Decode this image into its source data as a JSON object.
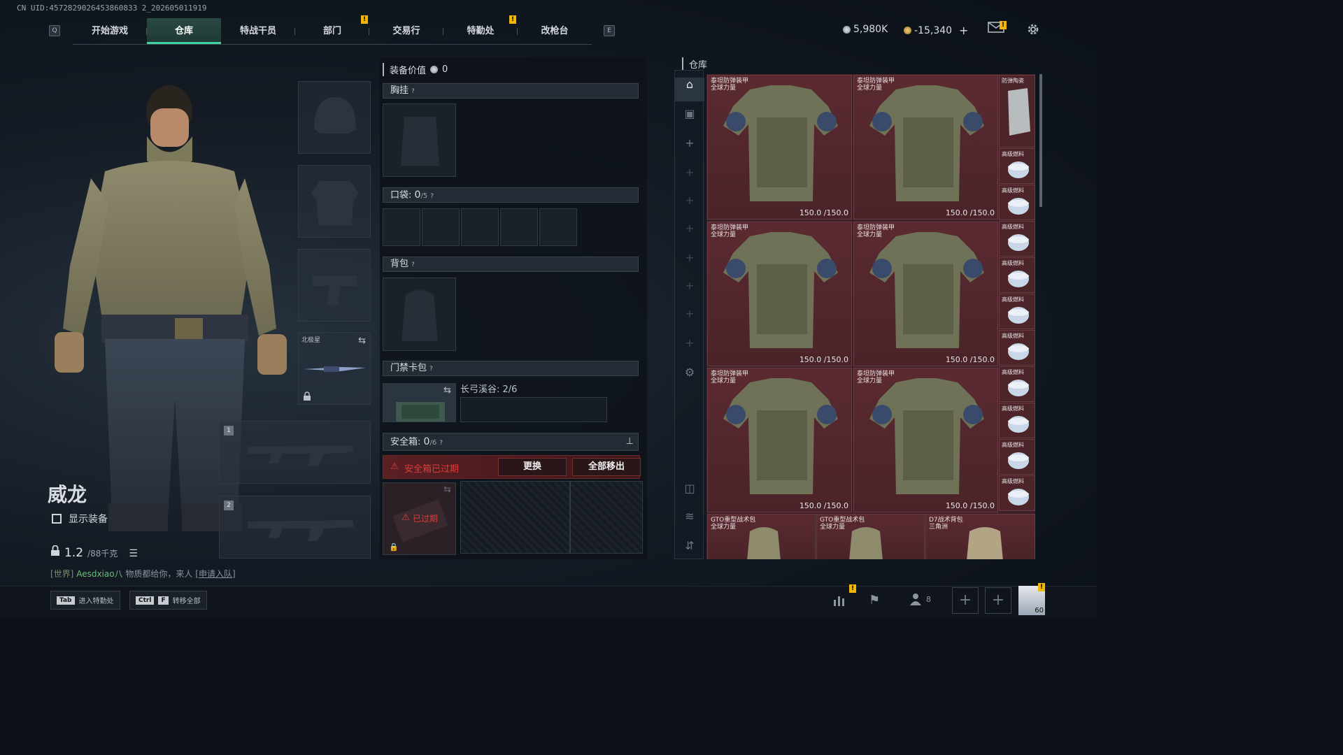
{
  "uid": "CN UID:4572829026453860833 2_202605011919",
  "topbar": {
    "keycap_left": "Q",
    "keycap_right": "E",
    "tabs": [
      "开始游戏",
      "仓库",
      "特战干员",
      "部门",
      "交易行",
      "特勤处",
      "改枪台"
    ],
    "active_tab": "仓库",
    "badge_mark": "!",
    "currency_silver": "5,980K",
    "currency_gold": "-15,340",
    "currency_add": "+"
  },
  "character": {
    "name": "威龙",
    "show_gear_label": "显示装备",
    "weight_value": "1.2",
    "weight_max": "/88千克"
  },
  "chat": {
    "channel": "[世界]",
    "name": "Aesdxiao八",
    "message": "物质都给你，来人",
    "apply": "[申请入队]"
  },
  "slots": {
    "melee_label": "北极星",
    "weapon1_num": "1",
    "weapon2_num": "2"
  },
  "middle": {
    "equip_value_label": "装备价值",
    "equip_value": "0",
    "chest_label": "胸挂",
    "q": "?",
    "pocket_label": "口袋:",
    "pocket_count": "0",
    "pocket_max": "/5",
    "backpack_label": "背包",
    "keycard_label": "门禁卡包",
    "keycard_map": "长弓溪谷: 2/6",
    "safebox_label": "安全箱:",
    "safebox_count": "0",
    "safebox_max": "/6",
    "safebox_expired": "安全箱已过期",
    "replace_btn": "更换",
    "remove_all_btn": "全部移出",
    "expired_tag": "已过期"
  },
  "warehouse": {
    "title": "仓库",
    "armor_items": [
      {
        "name1": "泰坦防弹装甲",
        "name2": "全球力量",
        "durability": "150.0 /150.0"
      },
      {
        "name1": "泰坦防弹装甲",
        "name2": "全球力量",
        "durability": "150.0 /150.0"
      },
      {
        "name1": "泰坦防弹装甲",
        "name2": "全球力量",
        "durability": "150.0 /150.0"
      },
      {
        "name1": "泰坦防弹装甲",
        "name2": "全球力量",
        "durability": "150.0 /150.0"
      },
      {
        "name1": "泰坦防弹装甲",
        "name2": "全球力量",
        "durability": "150.0 /150.0"
      },
      {
        "name1": "泰坦防弹装甲",
        "name2": "全球力量",
        "durability": "150.0 /150.0"
      }
    ],
    "plate_item": "防弹陶瓷",
    "fuel_items": [
      "高级燃料",
      "高级燃料",
      "高级燃料",
      "高级燃料",
      "高级燃料",
      "高级燃料",
      "高级燃料",
      "高级燃料",
      "高级燃料",
      "高级燃料"
    ],
    "bags": [
      {
        "name1": "GTO重型战术包",
        "name2": "全球力量"
      },
      {
        "name1": "GTO重型战术包",
        "name2": "全球力量"
      },
      {
        "name1": "D7战术背包",
        "name2": "三角洲"
      }
    ]
  },
  "bottom": {
    "hint1_key": "Tab",
    "hint1_text": "进入特勤处",
    "hint2_key1": "Ctrl",
    "hint2_key2": "F",
    "hint2_text": "转移全部",
    "friends_count": "8",
    "level": "60",
    "plus": "+"
  },
  "colors": {
    "accent": "#3fd1a2",
    "warning": "#e03b3b",
    "badge": "#f2b705",
    "item_bg": "#4a2329"
  }
}
